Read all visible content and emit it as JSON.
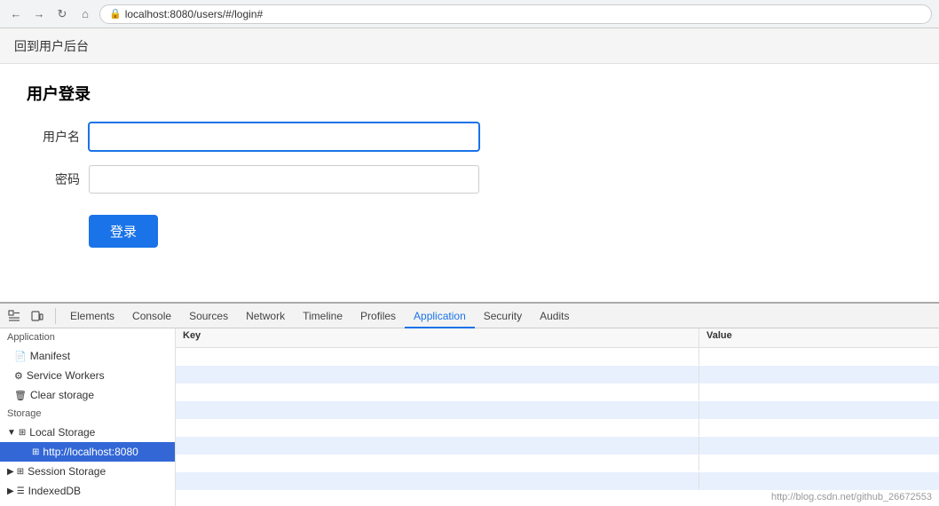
{
  "browser": {
    "url": "localhost:8080/users/#/login#"
  },
  "nav": {
    "link": "回到用户后台"
  },
  "login": {
    "title": "用户登录",
    "username_label": "用户名",
    "password_label": "密码",
    "login_button": "登录"
  },
  "devtools": {
    "tabs": [
      {
        "label": "Elements",
        "active": false
      },
      {
        "label": "Console",
        "active": false
      },
      {
        "label": "Sources",
        "active": false
      },
      {
        "label": "Network",
        "active": false
      },
      {
        "label": "Timeline",
        "active": false
      },
      {
        "label": "Profiles",
        "active": false
      },
      {
        "label": "Application",
        "active": true
      },
      {
        "label": "Security",
        "active": false
      },
      {
        "label": "Audits",
        "active": false
      }
    ],
    "sidebar": {
      "application_label": "Application",
      "items": [
        {
          "label": "Manifest",
          "icon": "📄"
        },
        {
          "label": "Service Workers",
          "icon": "⚙"
        },
        {
          "label": "Clear storage",
          "icon": "🗑"
        }
      ],
      "storage_label": "Storage",
      "local_storage_label": "Local Storage",
      "local_storage_child": "http://localhost:8080",
      "session_storage_label": "Session Storage",
      "indexed_db_label": "IndexedDB"
    },
    "table": {
      "key_header": "Key",
      "value_header": "Value",
      "rows": [
        {
          "key": "",
          "value": ""
        },
        {
          "key": "",
          "value": ""
        },
        {
          "key": "",
          "value": ""
        },
        {
          "key": "",
          "value": ""
        },
        {
          "key": "",
          "value": ""
        },
        {
          "key": "",
          "value": ""
        },
        {
          "key": "",
          "value": ""
        },
        {
          "key": "",
          "value": ""
        }
      ]
    },
    "watermark": "http://blog.csdn.net/github_26672553"
  }
}
